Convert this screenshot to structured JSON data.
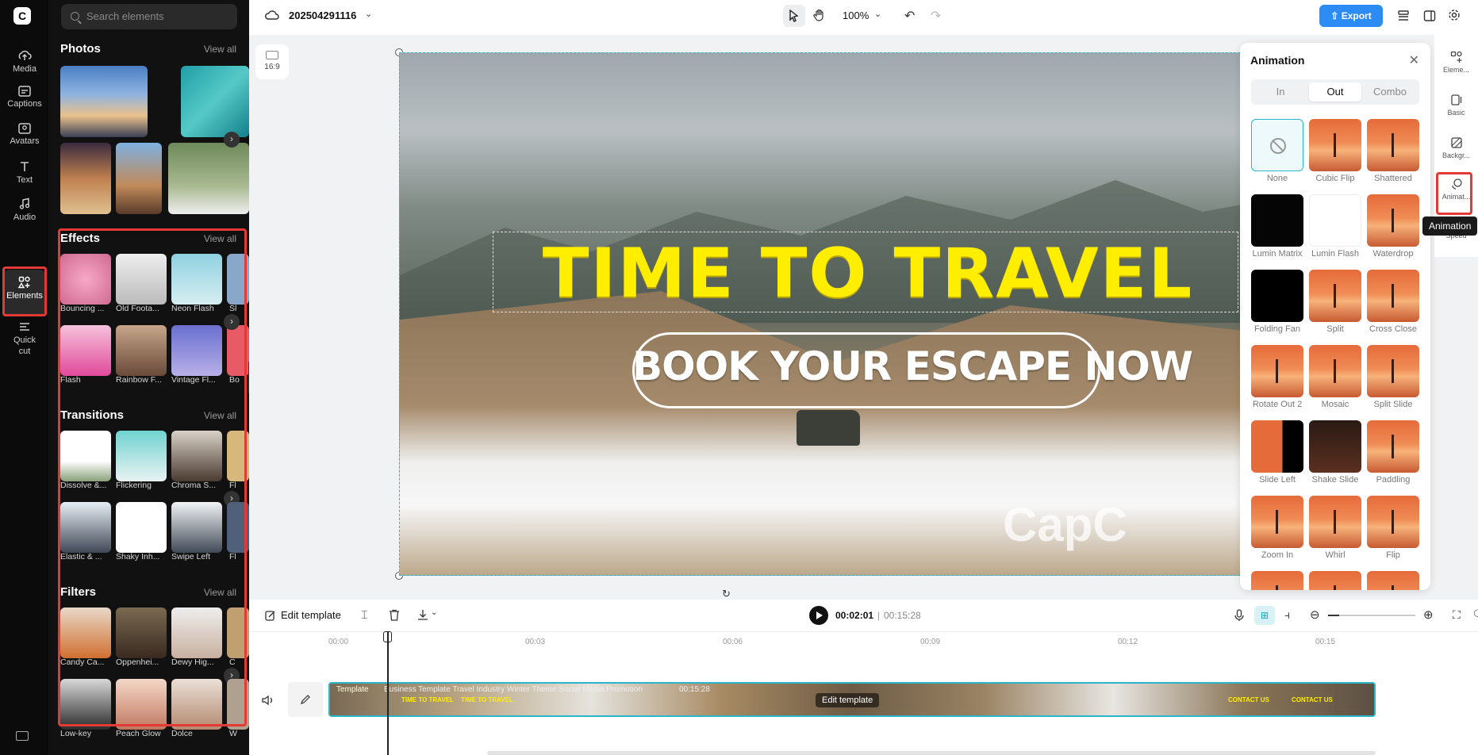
{
  "app": {
    "project_name": "202504291116",
    "zoom": "100%",
    "export_label": "Export",
    "canvas_ratio": "16:9"
  },
  "rail": {
    "items": [
      {
        "label": "Media"
      },
      {
        "label": "Captions"
      },
      {
        "label": "Avatars"
      },
      {
        "label": "Text"
      },
      {
        "label": "Audio"
      },
      {
        "label": "Elements"
      },
      {
        "label": "Quick cut"
      }
    ]
  },
  "panel": {
    "search_placeholder": "Search elements",
    "view_all": "View all",
    "photos": {
      "title": "Photos"
    },
    "effects": {
      "title": "Effects",
      "row1": [
        "Bouncing ...",
        "Old Foota...",
        "Neon Flash",
        "Sl"
      ],
      "row2": [
        "Flash",
        "Rainbow F...",
        "Vintage Fl...",
        "Bo"
      ]
    },
    "transitions": {
      "title": "Transitions",
      "row1": [
        "Dissolve &...",
        "Flickering",
        "Chroma S...",
        "Fl"
      ],
      "row2": [
        "Elastic & ...",
        "Shaky Inh...",
        "Swipe Left",
        "Fl"
      ]
    },
    "filters": {
      "title": "Filters",
      "row1": [
        "Candy Ca...",
        "Oppenhei...",
        "Dewy Hig...",
        "C"
      ],
      "row2": [
        "Low-key",
        "Peach Glow",
        "Dolce",
        "W"
      ]
    }
  },
  "canvas": {
    "headline": "TIME TO TRAVEL",
    "cta": "BOOK YOUR ESCAPE NOW",
    "watermark": "CapC"
  },
  "animation": {
    "title": "Animation",
    "tabs": [
      "In",
      "Out",
      "Combo"
    ],
    "active_tab": "Out",
    "items": [
      "None",
      "Cubic Flip",
      "Shattered",
      "Lumin Matrix",
      "Lumin Flash",
      "Waterdrop",
      "Folding Fan",
      "Split",
      "Cross Close",
      "Rotate Out 2",
      "Mosaic",
      "Split Slide",
      "Slide Left",
      "Shake Slide",
      "Paddling",
      "Zoom In",
      "Whirl",
      "Flip"
    ]
  },
  "right_sidebar": {
    "items": [
      "Eleme...",
      "Basic",
      "Backgr...",
      "Animat...",
      "Speed"
    ],
    "tooltip": "Animation"
  },
  "toolbar": {
    "edit_template": "Edit template",
    "current_time": "00:02:01",
    "total_time": "00:15:28"
  },
  "timeline": {
    "ruler": [
      "00:00",
      "00:03",
      "00:06",
      "00:09",
      "00:12",
      "00:15"
    ],
    "track_label": "Template",
    "track_title": "Business Template Travel Industry Winter Theme Social Media Promotion",
    "track_duration": "00:15:28",
    "track_edit": "Edit template",
    "thumb_text_1": "TIME TO TRAVEL",
    "thumb_text_2": "CONTACT US"
  }
}
